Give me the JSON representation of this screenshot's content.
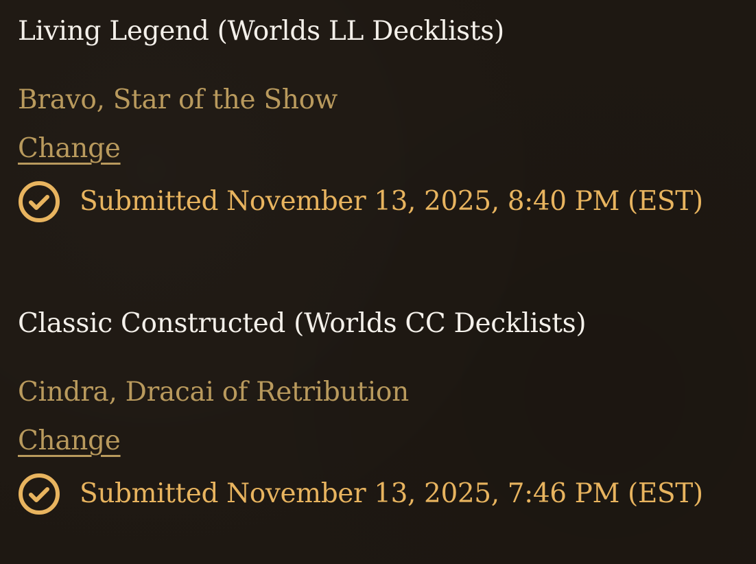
{
  "sections": [
    {
      "format_title": "Living Legend (Worlds LL Decklists)",
      "hero_name": "Bravo, Star of the Show",
      "change_label": "Change",
      "status_icon": "check-circle-icon",
      "status_text": "Submitted November 13, 2025, 8:40 PM (EST)"
    },
    {
      "format_title": "Classic Constructed (Worlds CC Decklists)",
      "hero_name": "Cindra, Dracai of Retribution",
      "change_label": "Change",
      "status_icon": "check-circle-icon",
      "status_text": "Submitted November 13, 2025, 7:46 PM (EST)"
    }
  ],
  "colors": {
    "background": "#1e1812",
    "title": "#f4f0ea",
    "muted_gold": "#b99a5d",
    "bright_gold": "#e8b45f"
  }
}
